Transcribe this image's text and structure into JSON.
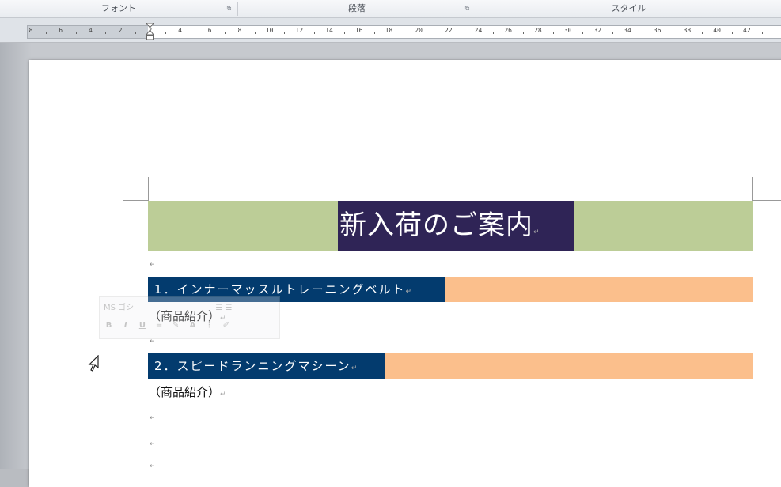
{
  "ribbon": {
    "groups": [
      {
        "label": "フォント"
      },
      {
        "label": "段落"
      },
      {
        "label": "スタイル"
      }
    ]
  },
  "ruler": {
    "labels": [
      "8",
      "6",
      "4",
      "2",
      "2",
      "4",
      "6",
      "8",
      "10",
      "12",
      "14",
      "16",
      "18",
      "20",
      "22",
      "24",
      "26",
      "28",
      "30",
      "32",
      "34",
      "36",
      "38",
      "40",
      "42"
    ]
  },
  "document": {
    "title": "新入荷のご案内",
    "paragraph_mark": "↵",
    "items": [
      {
        "heading": "1．インナーマッスルトレーニングベルト",
        "sub": "（商品紹介）"
      },
      {
        "heading": "2．スピードランニングマシーン",
        "sub": "（商品紹介）"
      }
    ]
  },
  "mini_toolbar": {
    "font_name": "MS ゴシ",
    "bold": "B",
    "italic": "I",
    "underline": "U"
  },
  "colors": {
    "title_band": "#bccd97",
    "title_highlight": "#2f2456",
    "item_band": "#fbbf8c",
    "item_highlight": "#033b6e"
  }
}
